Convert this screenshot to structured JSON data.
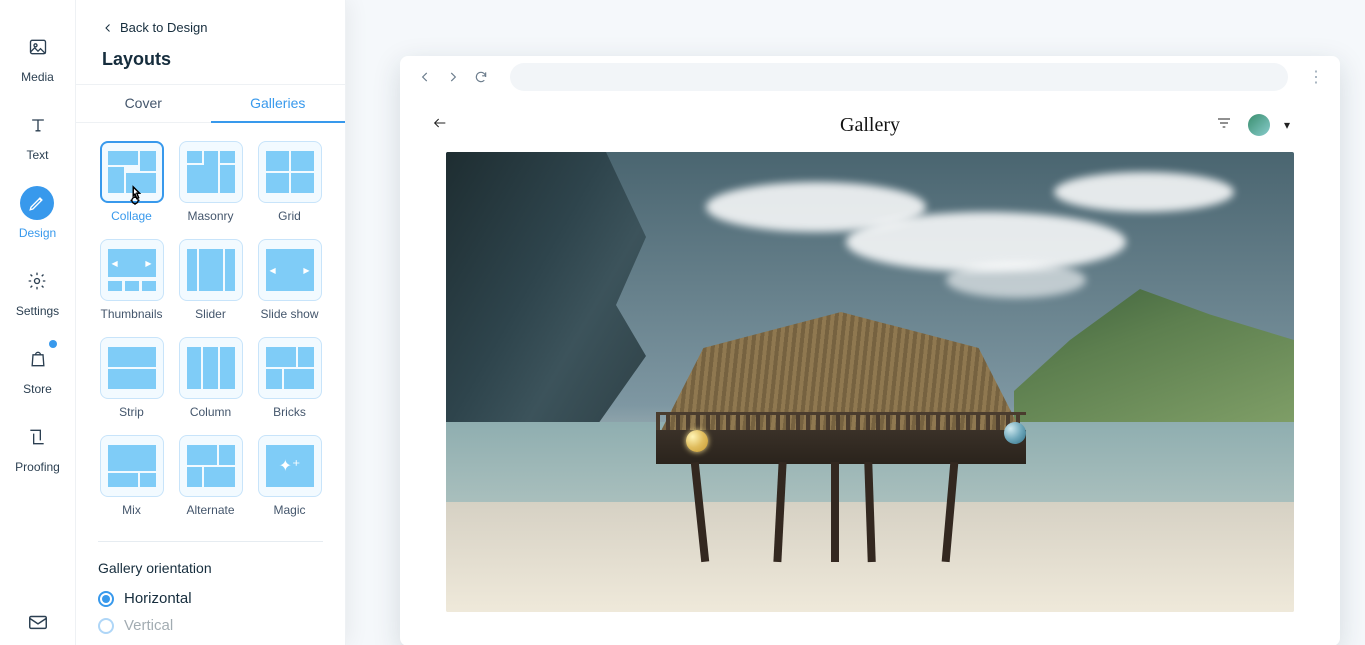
{
  "rail": {
    "items": [
      {
        "key": "media",
        "label": "Media"
      },
      {
        "key": "text",
        "label": "Text"
      },
      {
        "key": "design",
        "label": "Design"
      },
      {
        "key": "settings",
        "label": "Settings"
      },
      {
        "key": "store",
        "label": "Store"
      },
      {
        "key": "proofing",
        "label": "Proofing"
      }
    ],
    "active": "design"
  },
  "panel": {
    "back_label": "Back to Design",
    "title": "Layouts",
    "tabs": {
      "cover": "Cover",
      "galleries": "Galleries",
      "active": "galleries"
    },
    "layouts": {
      "collage": "Collage",
      "masonry": "Masonry",
      "grid": "Grid",
      "thumbnails": "Thumbnails",
      "slider": "Slider",
      "slide_show": "Slide show",
      "strip": "Strip",
      "column": "Column",
      "bricks": "Bricks",
      "mix": "Mix",
      "alternate": "Alternate",
      "magic": "Magic",
      "active": "collage"
    },
    "orientation": {
      "title": "Gallery orientation",
      "horizontal": "Horizontal",
      "vertical": "Vertical",
      "selected": "horizontal"
    }
  },
  "preview": {
    "page_title": "Gallery"
  }
}
